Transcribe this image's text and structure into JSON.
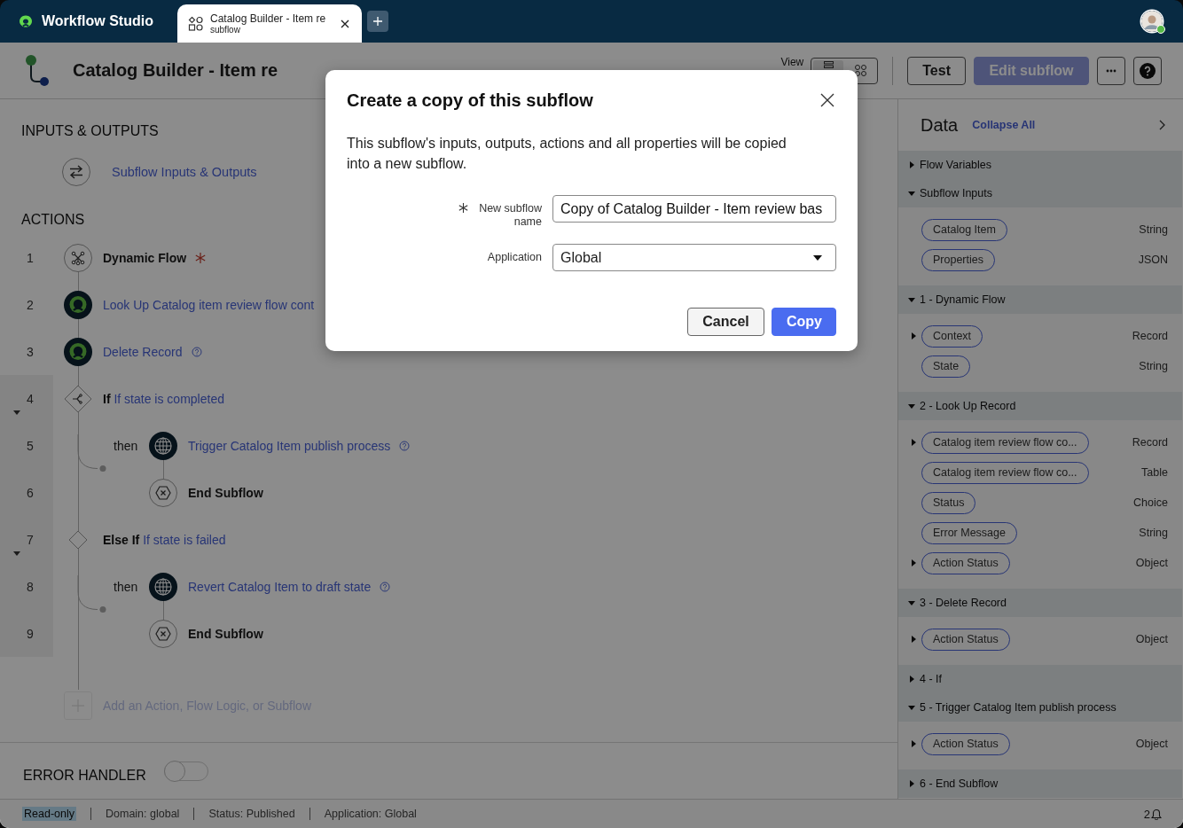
{
  "top_bar": {
    "app_name": "Workflow Studio",
    "tabs": [
      {
        "title": "Catalog Builder - Item re",
        "subtitle": "subflow",
        "selected": true
      }
    ]
  },
  "header": {
    "title": "Catalog Builder - Item re",
    "view_label": "View",
    "view_options": [
      {
        "kind": "list",
        "selected": true
      },
      {
        "kind": "diagram",
        "selected": false
      }
    ],
    "buttons": [
      {
        "kind": "outline",
        "label": "Test"
      },
      {
        "kind": "primary",
        "label": "Edit subflow",
        "disabled": true
      },
      {
        "kind": "more"
      },
      {
        "kind": "help"
      }
    ]
  },
  "canvas": {
    "inputs_title": "INPUTS & OUTPUTS",
    "inputs_link": "Subflow Inputs & Outputs",
    "actions_title": "ACTIONS",
    "steps": [
      {
        "number": "1",
        "kind": "dynamic",
        "title": "Dynamic Flow",
        "required": true
      },
      {
        "number": "2",
        "kind": "spoke",
        "link": "Look Up Catalog item review flow cont"
      },
      {
        "number": "3",
        "kind": "spoke",
        "link": "Delete Record",
        "help": true
      },
      {
        "number": "4",
        "kind": "if",
        "keyword": "If",
        "link": "If state is completed",
        "expanded": true,
        "children": [
          {
            "number": "5",
            "kind": "globe",
            "prefix": "then",
            "link": "Trigger Catalog Item publish process",
            "help": true
          },
          {
            "number": "6",
            "kind": "end",
            "title": "End Subflow"
          }
        ]
      },
      {
        "number": "7",
        "kind": "else-if",
        "keyword": "Else If",
        "link": "If state is failed",
        "expanded": true,
        "children": [
          {
            "number": "8",
            "kind": "globe",
            "prefix": "then",
            "link": "Revert Catalog Item to draft state",
            "help": true
          },
          {
            "number": "9",
            "kind": "end",
            "title": "End Subflow"
          }
        ]
      }
    ],
    "add_action": {
      "label": "Add an Action, Flow Logic, or Subflow",
      "disabled": true
    },
    "error_handler": {
      "label": "ERROR HANDLER",
      "on": false
    }
  },
  "data_panel": {
    "title": "Data",
    "collapse_link": "Collapse All",
    "sections": [
      {
        "title": "Flow Variables",
        "expanded": false
      },
      {
        "title": "Subflow Inputs",
        "expanded": true,
        "items": [
          {
            "label": "Catalog Item",
            "type": "String",
            "expandable": false
          },
          {
            "label": "Properties",
            "type": "JSON",
            "expandable": false
          }
        ]
      },
      {
        "title": "1 - Dynamic Flow",
        "expanded": true,
        "items": [
          {
            "label": "Context",
            "type": "Record",
            "expandable": true
          },
          {
            "label": "State",
            "type": "String",
            "expandable": false
          }
        ]
      },
      {
        "title": "2 - Look Up Record",
        "expanded": true,
        "items": [
          {
            "label": "Catalog item review flow co...",
            "type": "Record",
            "expandable": true
          },
          {
            "label": "Catalog item review flow co...",
            "type": "Table",
            "expandable": false
          },
          {
            "label": "Status",
            "type": "Choice",
            "expandable": false
          },
          {
            "label": "Error Message",
            "type": "String",
            "expandable": false
          },
          {
            "label": "Action Status",
            "type": "Object",
            "expandable": true
          }
        ]
      },
      {
        "title": "3 - Delete Record",
        "expanded": true,
        "items": [
          {
            "label": "Action Status",
            "type": "Object",
            "expandable": true
          }
        ]
      },
      {
        "title": "4 - If",
        "expanded": false
      },
      {
        "title": "5 - Trigger Catalog Item publish process",
        "expanded": true,
        "items": [
          {
            "label": "Action Status",
            "type": "Object",
            "expandable": true
          }
        ]
      },
      {
        "title": "6 - End Subflow",
        "expanded": false
      }
    ]
  },
  "status_bar": {
    "items": [
      {
        "text": "Read-only",
        "kind": "badge"
      },
      {
        "text": "Domain: global",
        "kind": "text"
      },
      {
        "text": "Status: Published",
        "kind": "text"
      },
      {
        "text": "Application: Global",
        "kind": "text"
      }
    ],
    "notifications": "2"
  },
  "dialog": {
    "title": "Create a copy of this subflow",
    "description": "This subflow's inputs, outputs, actions and all properties will be copied into a new subflow.",
    "fields": [
      {
        "kind": "text",
        "label": "New subflow name",
        "required": true,
        "value": "Copy of Catalog Builder - Item review bas"
      },
      {
        "kind": "select",
        "label": "Application",
        "required": false,
        "value": "Global"
      }
    ],
    "buttons": [
      {
        "kind": "secondary",
        "label": "Cancel"
      },
      {
        "kind": "primary",
        "label": "Copy"
      }
    ]
  }
}
